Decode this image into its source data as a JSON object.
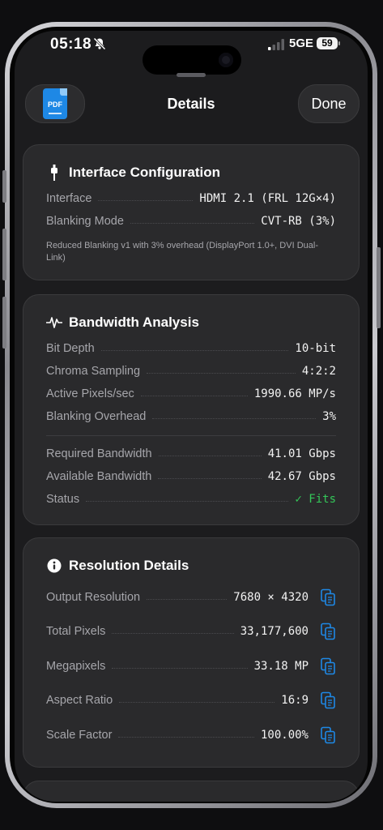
{
  "status_bar": {
    "time": "05:18",
    "network": "5GE",
    "battery": "59"
  },
  "nav": {
    "pdf_label": "PDF",
    "title": "Details",
    "done_label": "Done"
  },
  "interface_card": {
    "title": "Interface Configuration",
    "rows": [
      {
        "label": "Interface",
        "value": "HDMI 2.1 (FRL 12G×4)"
      },
      {
        "label": "Blanking Mode",
        "value": "CVT-RB (3%)"
      }
    ],
    "note": "Reduced Blanking v1 with 3% overhead (DisplayPort 1.0+, DVI Dual-Link)"
  },
  "bandwidth_card": {
    "title": "Bandwidth Analysis",
    "rows": [
      {
        "label": "Bit Depth",
        "value": "10-bit"
      },
      {
        "label": "Chroma Sampling",
        "value": "4:2:2"
      },
      {
        "label": "Active Pixels/sec",
        "value": "1990.66 MP/s"
      },
      {
        "label": "Blanking Overhead",
        "value": "3%"
      }
    ],
    "rows2": [
      {
        "label": "Required Bandwidth",
        "value": "41.01 Gbps"
      },
      {
        "label": "Available Bandwidth",
        "value": "42.67 Gbps"
      },
      {
        "label": "Status",
        "value": "✓ Fits"
      }
    ]
  },
  "resolution_card": {
    "title": "Resolution Details",
    "rows": [
      {
        "label": "Output Resolution",
        "value": "7680 × 4320"
      },
      {
        "label": "Total Pixels",
        "value": "33,177,600"
      },
      {
        "label": "Megapixels",
        "value": "33.18 MP"
      },
      {
        "label": "Aspect Ratio",
        "value": "16:9"
      },
      {
        "label": "Scale Factor",
        "value": "100.00%"
      }
    ]
  },
  "colors": {
    "accent_blue": "#1e88e5",
    "status_ok": "#34c759",
    "card_bg": "#2a2a2c"
  }
}
